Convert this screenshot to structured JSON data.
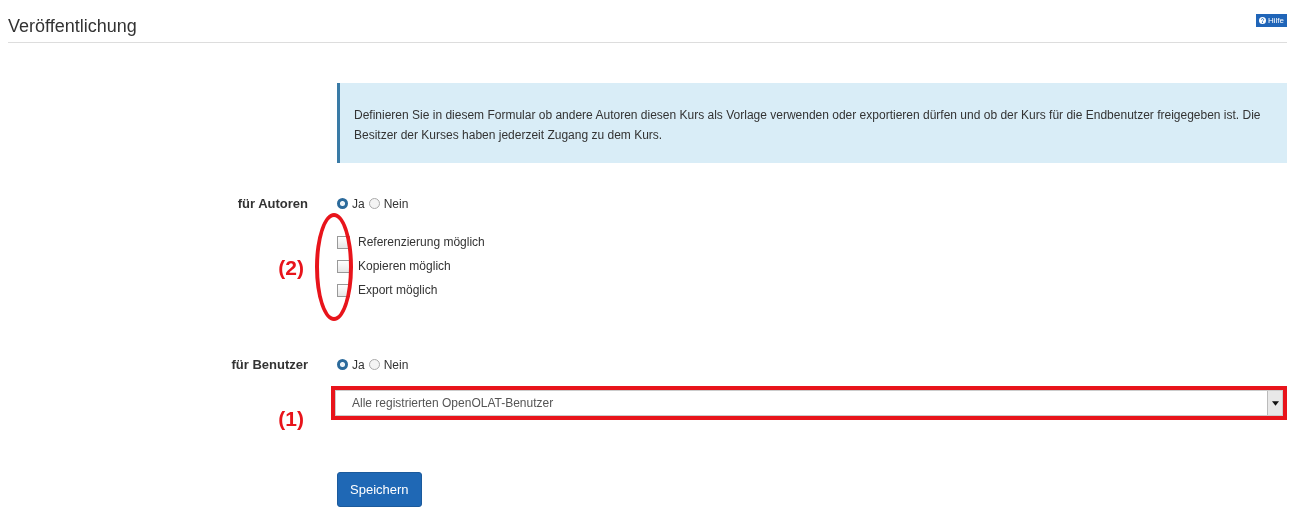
{
  "header": {
    "title": "Veröffentlichung",
    "help_button": "Hilfe"
  },
  "info": "Definieren Sie in diesem Formular ob andere Autoren diesen Kurs als Vorlage verwenden oder exportieren dürfen und ob der Kurs für die Endbenutzer freigegeben ist. Die Besitzer der Kurses haben jederzeit Zugang zu dem Kurs.",
  "authors": {
    "label": "für Autoren",
    "options": [
      {
        "label": "Ja",
        "selected": true
      },
      {
        "label": "Nein",
        "selected": false
      }
    ],
    "checkboxes": [
      {
        "label": "Referenzierung möglich",
        "checked": false
      },
      {
        "label": "Kopieren möglich",
        "checked": false
      },
      {
        "label": "Export möglich",
        "checked": false
      }
    ],
    "annotation": "(2)"
  },
  "users": {
    "label": "für Benutzer",
    "options": [
      {
        "label": "Ja",
        "selected": true
      },
      {
        "label": "Nein",
        "selected": false
      }
    ],
    "select": {
      "value": "Alle registrierten OpenOLAT-Benutzer"
    },
    "annotation": "(1)"
  },
  "save_button": "Speichern"
}
